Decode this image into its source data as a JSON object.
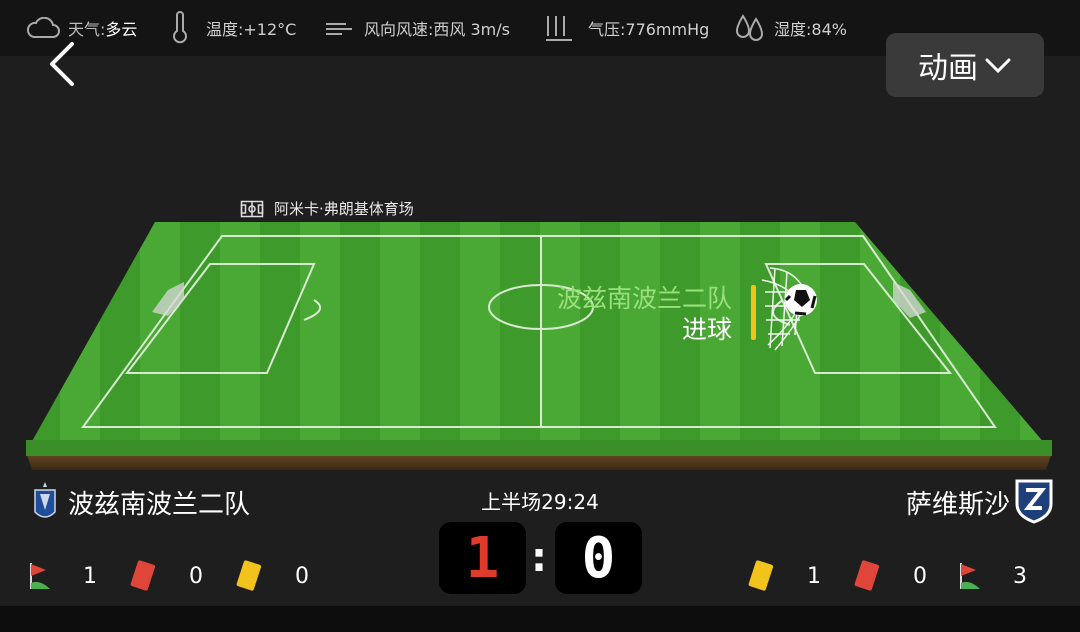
{
  "weather": {
    "condition_label": "天气:",
    "condition_value": "多云",
    "temperature": "温度:+12°C",
    "wind": "风向风速:西风 3m/s",
    "pressure": "气压:776mmHg",
    "humidity": "湿度:84%"
  },
  "animation_button": {
    "label": "动画"
  },
  "stadium": {
    "name": "阿米卡·弗朗基体育场"
  },
  "event": {
    "team": "波兹南波兰二队",
    "action": "进球",
    "accent_color": "#f0c419"
  },
  "match": {
    "period": "上半场29:24",
    "home": {
      "name": "波兹南波兰二队",
      "score": "1",
      "score_color": "#e03a2a",
      "corners": "1",
      "red_cards": "0",
      "yellow_cards": "0"
    },
    "away": {
      "name": "萨维斯沙",
      "score": "0",
      "score_color": "#ffffff",
      "yellow_cards": "1",
      "red_cards": "0",
      "corners": "3"
    }
  },
  "colors": {
    "grass": "#3f9a2c",
    "red_card": "#e0453a",
    "yellow_card": "#f2c31a"
  },
  "icons": [
    "cloud-icon",
    "thermometer-icon",
    "wind-icon",
    "pressure-icon",
    "humidity-icon",
    "back-chevron-icon",
    "chevron-down-icon",
    "stadium-icon",
    "corner-flag-icon",
    "red-card-icon",
    "yellow-card-icon",
    "team-crest-icon",
    "ball-icon",
    "goal-net-icon"
  ]
}
